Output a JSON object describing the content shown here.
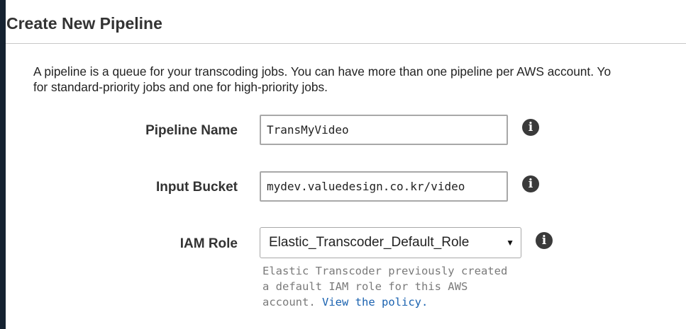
{
  "page": {
    "title": "Create New Pipeline",
    "description_line1": "A pipeline is a queue for your transcoding jobs. You can have more than one pipeline per AWS account. Yo",
    "description_line2": "for standard-priority jobs and one for high-priority jobs."
  },
  "form": {
    "pipeline_name": {
      "label": "Pipeline Name",
      "value": "TransMyVideo"
    },
    "input_bucket": {
      "label": "Input Bucket",
      "value": "mydev.valuedesign.co.kr/video"
    },
    "iam_role": {
      "label": "IAM Role",
      "selected": "Elastic_Transcoder_Default_Role",
      "help_line1": "Elastic Transcoder previously created",
      "help_line2": "a default IAM role for this AWS",
      "help_line3_prefix": "account.",
      "help_link": "View the policy."
    }
  },
  "icons": {
    "info": "info-icon",
    "select_arrow": "dropdown-arrow-icon"
  },
  "colors": {
    "sidebar": "#152231",
    "link": "#1a62b0",
    "help_text": "#7a7a7a",
    "icon": "#3a3a3a"
  }
}
